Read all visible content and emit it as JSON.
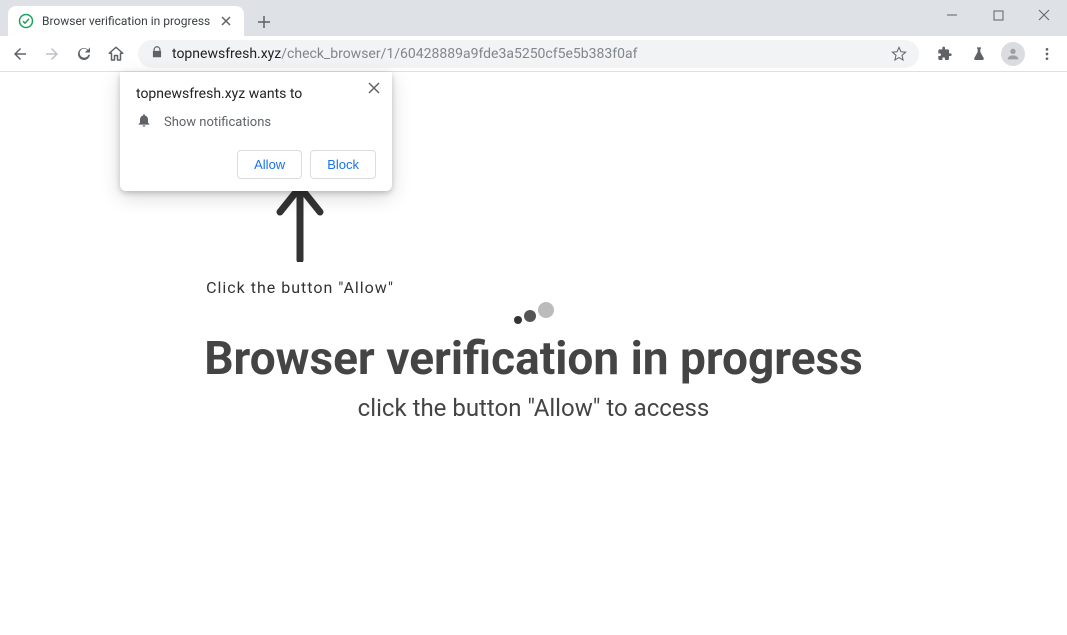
{
  "tab": {
    "title": "Browser verification in progress"
  },
  "url": {
    "host": "topnewsfresh.xyz",
    "path": "/check_browser/1/60428889a9fde3a5250cf5e5b383f0af"
  },
  "permission_popup": {
    "title": "topnewsfresh.xyz wants to",
    "permission_label": "Show notifications",
    "allow_label": "Allow",
    "block_label": "Block"
  },
  "hint": {
    "text": "Click the button \"Allow\""
  },
  "page_content": {
    "heading": "Browser verification in progress",
    "subheading": "click the button \"Allow\" to access"
  }
}
